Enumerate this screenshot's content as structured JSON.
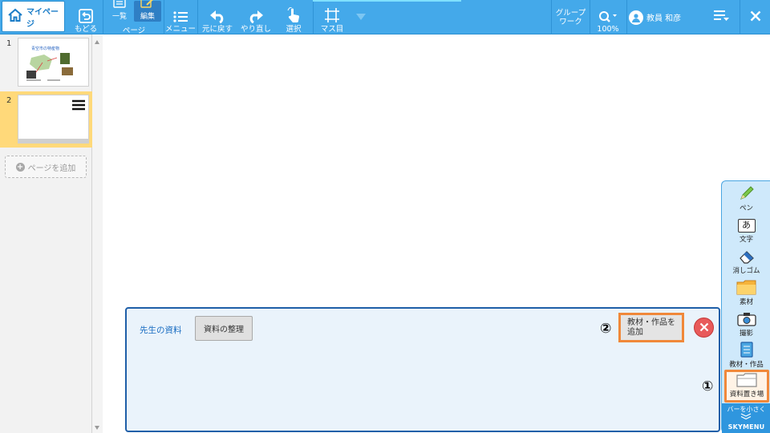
{
  "toolbar": {
    "mypage_label": "マイページ",
    "back_label": "もどる",
    "list_label": "一覧",
    "edit_label": "編集",
    "page_group_label": "ページ",
    "menu_label": "メニュー",
    "undo_label": "元に戻す",
    "redo_label": "やり直し",
    "select_label": "選択",
    "grid_label": "マス目",
    "group_work_line1": "グループ",
    "group_work_line2": "ワーク",
    "zoom_label": "100%",
    "user_name": "教員 和彦"
  },
  "pages": {
    "items": [
      {
        "number": "1",
        "thumb_title": "青空市の特産物"
      },
      {
        "number": "2"
      }
    ],
    "add_page_label": "ページを追加"
  },
  "drawer": {
    "title": "先生の資料",
    "organize_label": "資料の整理",
    "add_material_line1": "教材・作品を",
    "add_material_line2": "追加"
  },
  "palette": {
    "pen_label": "ペン",
    "text_label": "文字",
    "text_glyph": "あ",
    "eraser_label": "消しゴム",
    "material_label": "素材",
    "photo_label": "撮影",
    "works_label": "教材・作品",
    "storage_label": "資料置き場",
    "shrink_label": "バーを小さく",
    "brand": "SKYMENU"
  },
  "markers": {
    "step1": "①",
    "step2": "②"
  },
  "colors": {
    "toolbar_bg": "#44a9ea",
    "highlight_orange": "#f0883a",
    "selected_page": "#ffd97a",
    "close_red": "#e85a5a"
  }
}
